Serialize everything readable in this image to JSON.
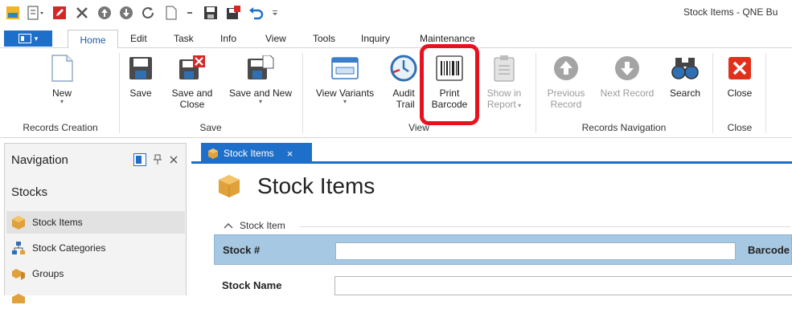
{
  "window": {
    "title": "Stock Items - QNE Bu"
  },
  "quick_access": {
    "icons": [
      "app-logo-icon",
      "document-icon",
      "edit-icon",
      "close-icon",
      "up-icon",
      "down-icon",
      "refresh-icon",
      "new-page-icon",
      "save-icon",
      "save-close-icon",
      "undo-icon"
    ]
  },
  "tabs": {
    "app_menu_caret": "▾",
    "items": [
      "Home",
      "Edit",
      "Task",
      "Info",
      "View",
      "Tools",
      "Inquiry",
      "Maintenance"
    ]
  },
  "ribbon": {
    "buttons": {
      "new": "New",
      "save": "Save",
      "save_close_1": "Save and",
      "save_close_2": "Close",
      "save_new": "Save and New",
      "view_variants": "View Variants",
      "audit_1": "Audit",
      "audit_2": "Trail",
      "print_1": "Print",
      "print_2": "Barcode",
      "show_1": "Show in",
      "show_2": "Report",
      "prev_1": "Previous",
      "prev_2": "Record",
      "next": "Next Record",
      "search": "Search",
      "close": "Close"
    },
    "groups": {
      "records_creation": "Records Creation",
      "save": "Save",
      "view": "View",
      "records_navigation": "Records Navigation",
      "close": "Close"
    }
  },
  "navigation": {
    "title": "Navigation",
    "section": "Stocks",
    "items": [
      "Stock Items",
      "Stock Categories",
      "Groups"
    ]
  },
  "document": {
    "tab_label": "Stock Items",
    "tab_close": "×",
    "heading": "Stock Items",
    "section_label": "Stock Item",
    "fields": {
      "stock_no": {
        "label": "Stock #",
        "value": ""
      },
      "barcode": {
        "label": "Barcode"
      },
      "stock_name": {
        "label": "Stock Name"
      }
    }
  },
  "colors": {
    "accent": "#1e6fc9",
    "highlight": "#e8121f",
    "field_row": "#a6c8e3"
  }
}
